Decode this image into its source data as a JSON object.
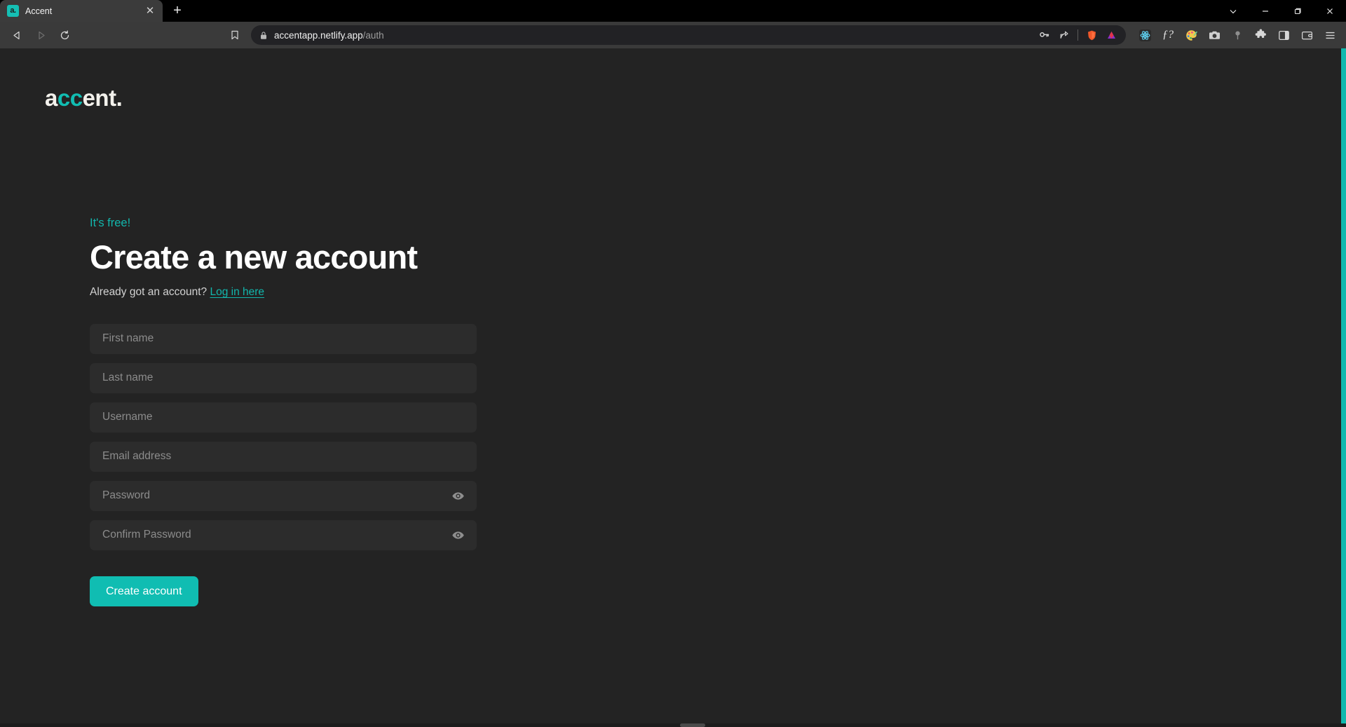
{
  "browser": {
    "tab": {
      "title": "Accent",
      "favicon_text": "a.",
      "favicon_name": "accent-favicon",
      "close_glyph": "✕"
    },
    "new_tab_glyph": "+",
    "window_controls": [
      {
        "name": "tab-search-button",
        "glyph": "⌄"
      },
      {
        "name": "minimize-button",
        "glyph": "—"
      },
      {
        "name": "maximize-button",
        "glyph": "❐"
      },
      {
        "name": "close-window-button",
        "glyph": "✕"
      }
    ],
    "nav": {
      "back_glyph": "◁",
      "forward_glyph": "▷",
      "reload_glyph": "↻"
    },
    "bookmark_glyph": "☐",
    "url": {
      "host": "accentapp.netlify.app",
      "path": "/auth",
      "lock_glyph": "🔒"
    },
    "url_actions": [
      {
        "name": "password-key-icon",
        "glyph": "⚷"
      },
      {
        "name": "share-icon",
        "glyph": "↪"
      },
      {
        "name": "brave-shields-icon",
        "glyph": "▲"
      },
      {
        "name": "brave-rewards-icon",
        "glyph": "△"
      }
    ],
    "toolbar_icons": [
      {
        "name": "react-devtools-icon",
        "glyph": "⚛"
      },
      {
        "name": "font-inspector-icon",
        "glyph": "ƒ?"
      },
      {
        "name": "color-picker-icon",
        "glyph": "◕"
      },
      {
        "name": "screenshot-camera-icon",
        "glyph": "⎙"
      },
      {
        "name": "pin-icon",
        "glyph": "⚑"
      },
      {
        "name": "extensions-puzzle-icon",
        "glyph": "❖"
      },
      {
        "name": "sidebar-toggle-icon",
        "glyph": "◫"
      },
      {
        "name": "wallet-icon",
        "glyph": "▤"
      },
      {
        "name": "browser-menu-icon",
        "glyph": "☰"
      }
    ]
  },
  "page": {
    "logo": {
      "part1": "a",
      "part2": "cc",
      "part3": "ent."
    },
    "eyebrow": "It's free!",
    "headline": "Create a new account",
    "subline_text": "Already got an account?",
    "subline_link": "Log in here",
    "fields": [
      {
        "name": "first-name-input",
        "placeholder": "First name",
        "value": "",
        "type": "text",
        "eye": false
      },
      {
        "name": "last-name-input",
        "placeholder": "Last name",
        "value": "",
        "type": "text",
        "eye": false
      },
      {
        "name": "username-input",
        "placeholder": "Username",
        "value": "",
        "type": "text",
        "eye": false
      },
      {
        "name": "email-input",
        "placeholder": "Email address",
        "value": "",
        "type": "text",
        "eye": false
      },
      {
        "name": "password-input",
        "placeholder": "Password",
        "value": "",
        "type": "password",
        "eye": true
      },
      {
        "name": "confirm-password-input",
        "placeholder": "Confirm Password",
        "value": "",
        "type": "password",
        "eye": true
      }
    ],
    "submit_label": "Create account",
    "colors": {
      "accent": "#10bdb2",
      "background": "#232323",
      "input_background": "#2c2c2c",
      "text": "#ffffff",
      "placeholder": "#8c8c8c"
    }
  }
}
